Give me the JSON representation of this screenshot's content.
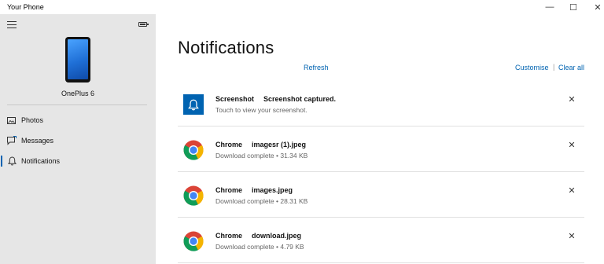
{
  "window": {
    "title": "Your Phone",
    "minimize_glyph": "—",
    "maximize_glyph": "☐",
    "close_glyph": "✕"
  },
  "sidebar": {
    "device_name": "OnePlus 6",
    "items": [
      {
        "label": "Photos",
        "icon": "photos-icon"
      },
      {
        "label": "Messages",
        "icon": "messages-icon"
      },
      {
        "label": "Notifications",
        "icon": "bell-icon",
        "active": true
      }
    ]
  },
  "main": {
    "heading": "Notifications",
    "refresh_label": "Refresh",
    "customise_label": "Customise",
    "separator": "|",
    "clear_all_label": "Clear all",
    "notifications": [
      {
        "app": "Screenshot",
        "title": "Screenshot captured.",
        "body": "Touch to view your screenshot.",
        "icon": "screenshot-bell-icon"
      },
      {
        "app": "Chrome",
        "title": "imagesr (1).jpeg",
        "body": "Download complete • 31.34 KB",
        "icon": "chrome-icon"
      },
      {
        "app": "Chrome",
        "title": "images.jpeg",
        "body": "Download complete • 28.31 KB",
        "icon": "chrome-icon"
      },
      {
        "app": "Chrome",
        "title": "download.jpeg",
        "body": "Download complete • 4.79 KB",
        "icon": "chrome-icon"
      }
    ],
    "dismiss_glyph": "✕"
  },
  "colors": {
    "accent": "#0063b1",
    "sidebar_bg": "#e6e6e6"
  }
}
